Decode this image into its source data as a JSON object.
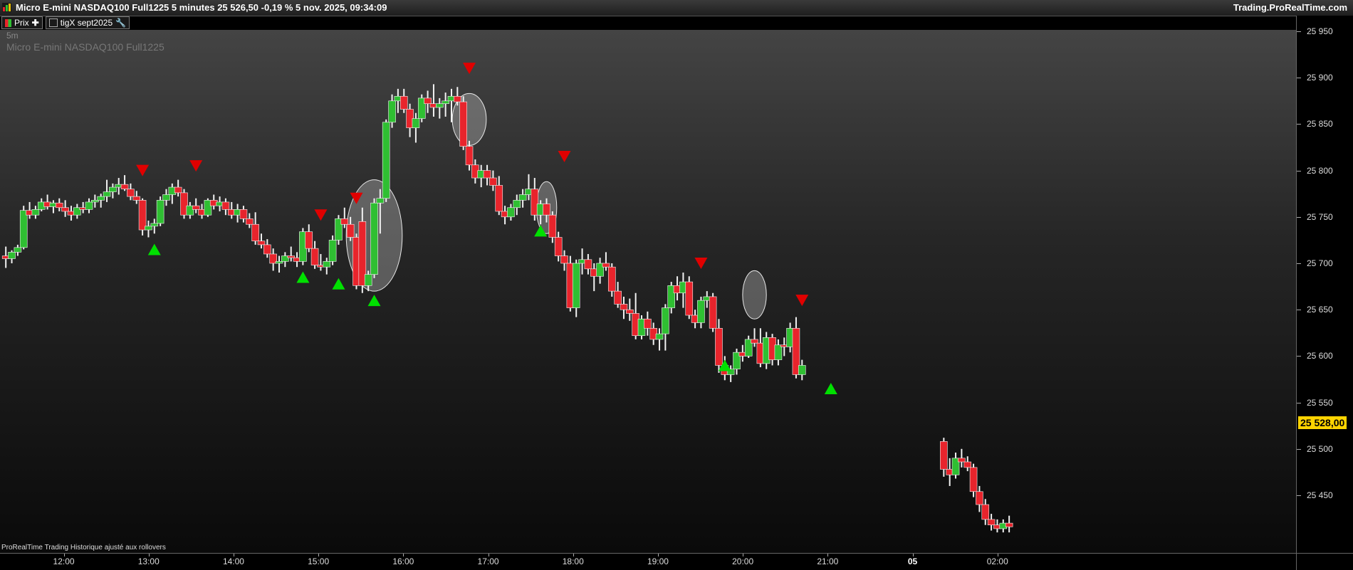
{
  "window": {
    "title": "Micro E-mini NASDAQ100 Full1225 5 minutes 25 526,50 -0,19 % 5 nov. 2025, 09:34:09",
    "brand": "Trading.ProRealTime.com"
  },
  "toolbar": {
    "price_label": "Prix",
    "indicator_label": "tigX sept2025"
  },
  "chart_labels": {
    "timeframe": "5m",
    "instrument": "Micro E-mini NASDAQ100 Full1225",
    "footer": "ProRealTime Trading  Historique ajusté aux rollovers"
  },
  "colors": {
    "up": "#2fbf32",
    "down": "#e8242c",
    "buy_signal": "#00e000",
    "sell_signal": "#e00000",
    "last_price_bg": "#ffd400"
  },
  "price_axis": {
    "labels": [
      "25 950",
      "25 900",
      "25 850",
      "25 800",
      "25 750",
      "25 700",
      "25 650",
      "25 600",
      "25 550",
      "25 500",
      "25 450"
    ],
    "last_price": "25 528,00"
  },
  "time_axis": {
    "labels": [
      {
        "text": "12:00",
        "bold": false,
        "x": 12.0
      },
      {
        "text": "13:00",
        "bold": false,
        "x": 13.0
      },
      {
        "text": "14:00",
        "bold": false,
        "x": 14.0
      },
      {
        "text": "15:00",
        "bold": false,
        "x": 15.0
      },
      {
        "text": "16:00",
        "bold": false,
        "x": 16.0
      },
      {
        "text": "17:00",
        "bold": false,
        "x": 17.0
      },
      {
        "text": "18:00",
        "bold": false,
        "x": 18.0
      },
      {
        "text": "19:00",
        "bold": false,
        "x": 19.0
      },
      {
        "text": "20:00",
        "bold": false,
        "x": 20.0
      },
      {
        "text": "21:00",
        "bold": false,
        "x": 21.0
      },
      {
        "text": "05",
        "bold": true,
        "x": 22.0
      },
      {
        "text": "02:00",
        "bold": false,
        "x": 23.0
      }
    ]
  },
  "chart_data": {
    "type": "candlestick",
    "x_unit": "hours",
    "ylim": [
      25410,
      25960
    ],
    "xlim": [
      11.32,
      24.7
    ],
    "candles": [
      [
        11.33,
        25708,
        25718,
        25695,
        25705
      ],
      [
        11.4,
        25705,
        25714,
        25700,
        25712
      ],
      [
        11.47,
        25712,
        25720,
        25708,
        25717
      ],
      [
        11.54,
        25717,
        25762,
        25715,
        25757
      ],
      [
        11.61,
        25757,
        25766,
        25748,
        25752
      ],
      [
        11.68,
        25752,
        25762,
        25748,
        25758
      ],
      [
        11.75,
        25758,
        25770,
        25756,
        25766
      ],
      [
        11.82,
        25766,
        25774,
        25758,
        25761
      ],
      [
        11.89,
        25761,
        25768,
        25754,
        25765
      ],
      [
        11.96,
        25765,
        25770,
        25756,
        25760
      ],
      [
        12.03,
        25760,
        25768,
        25750,
        25756
      ],
      [
        12.1,
        25756,
        25762,
        25746,
        25752
      ],
      [
        12.17,
        25752,
        25764,
        25748,
        25760
      ],
      [
        12.24,
        25760,
        25766,
        25754,
        25758
      ],
      [
        12.31,
        25758,
        25770,
        25754,
        25766
      ],
      [
        12.38,
        25766,
        25774,
        25760,
        25768
      ],
      [
        12.45,
        25768,
        25775,
        25760,
        25772
      ],
      [
        12.52,
        25772,
        25790,
        25766,
        25777
      ],
      [
        12.59,
        25777,
        25786,
        25770,
        25782
      ],
      [
        12.66,
        25782,
        25792,
        25774,
        25785
      ],
      [
        12.73,
        25785,
        25795,
        25778,
        25780
      ],
      [
        12.8,
        25780,
        25786,
        25768,
        25772
      ],
      [
        12.87,
        25772,
        25778,
        25764,
        25768
      ],
      [
        12.94,
        25768,
        25770,
        25730,
        25736
      ],
      [
        13.01,
        25736,
        25746,
        25728,
        25740
      ],
      [
        13.08,
        25740,
        25748,
        25732,
        25743
      ],
      [
        13.15,
        25743,
        25772,
        25740,
        25768
      ],
      [
        13.22,
        25768,
        25780,
        25762,
        25774
      ],
      [
        13.29,
        25774,
        25786,
        25764,
        25782
      ],
      [
        13.36,
        25782,
        25790,
        25772,
        25776
      ],
      [
        13.43,
        25776,
        25780,
        25748,
        25752
      ],
      [
        13.5,
        25752,
        25766,
        25748,
        25762
      ],
      [
        13.57,
        25762,
        25770,
        25754,
        25758
      ],
      [
        13.64,
        25758,
        25764,
        25748,
        25752
      ],
      [
        13.71,
        25752,
        25770,
        25750,
        25768
      ],
      [
        13.78,
        25768,
        25774,
        25758,
        25762
      ],
      [
        13.85,
        25762,
        25772,
        25756,
        25766
      ],
      [
        13.92,
        25766,
        25770,
        25752,
        25758
      ],
      [
        13.99,
        25758,
        25766,
        25748,
        25752
      ],
      [
        14.06,
        25752,
        25764,
        25744,
        25758
      ],
      [
        14.13,
        25758,
        25762,
        25744,
        25748
      ],
      [
        14.2,
        25748,
        25754,
        25738,
        25742
      ],
      [
        14.27,
        25742,
        25755,
        25720,
        25724
      ],
      [
        14.34,
        25724,
        25732,
        25716,
        25720
      ],
      [
        14.41,
        25720,
        25726,
        25706,
        25710
      ],
      [
        14.48,
        25710,
        25716,
        25692,
        25700
      ],
      [
        14.55,
        25700,
        25708,
        25690,
        25702
      ],
      [
        14.62,
        25702,
        25712,
        25696,
        25708
      ],
      [
        14.69,
        25708,
        25718,
        25702,
        25706
      ],
      [
        14.76,
        25706,
        25712,
        25696,
        25702
      ],
      [
        14.83,
        25702,
        25738,
        25698,
        25734
      ],
      [
        14.9,
        25734,
        25742,
        25712,
        25716
      ],
      [
        14.97,
        25716,
        25724,
        25694,
        25698
      ],
      [
        15.04,
        25698,
        25710,
        25692,
        25696
      ],
      [
        15.11,
        25696,
        25706,
        25688,
        25702
      ],
      [
        15.18,
        25702,
        25730,
        25698,
        25725
      ],
      [
        15.25,
        25725,
        25752,
        25720,
        25748
      ],
      [
        15.32,
        25748,
        25760,
        25738,
        25742
      ],
      [
        15.39,
        25742,
        25750,
        25724,
        25728
      ],
      [
        15.46,
        25728,
        25732,
        25672,
        25676
      ],
      [
        15.53,
        25745,
        25760,
        25668,
        25676
      ],
      [
        15.6,
        25676,
        25692,
        25670,
        25688
      ],
      [
        15.67,
        25688,
        25770,
        25684,
        25765
      ],
      [
        15.74,
        25765,
        25780,
        25732,
        25770
      ],
      [
        15.81,
        25770,
        25855,
        25766,
        25852
      ],
      [
        15.88,
        25852,
        25882,
        25846,
        25875
      ],
      [
        15.95,
        25875,
        25888,
        25862,
        25880
      ],
      [
        16.02,
        25880,
        25888,
        25862,
        25866
      ],
      [
        16.09,
        25866,
        25872,
        25836,
        25846
      ],
      [
        16.16,
        25846,
        25862,
        25830,
        25856
      ],
      [
        16.23,
        25856,
        25882,
        25852,
        25878
      ],
      [
        16.3,
        25878,
        25886,
        25862,
        25872
      ],
      [
        16.37,
        25872,
        25893,
        25858,
        25868
      ],
      [
        16.44,
        25868,
        25878,
        25856,
        25872
      ],
      [
        16.51,
        25872,
        25884,
        25858,
        25875
      ],
      [
        16.58,
        25875,
        25888,
        25852,
        25880
      ],
      [
        16.65,
        25880,
        25890,
        25870,
        25874
      ],
      [
        16.72,
        25874,
        25880,
        25822,
        25826
      ],
      [
        16.79,
        25826,
        25832,
        25800,
        25806
      ],
      [
        16.86,
        25806,
        25812,
        25786,
        25792
      ],
      [
        16.93,
        25792,
        25806,
        25782,
        25800
      ],
      [
        17.0,
        25800,
        25806,
        25784,
        25792
      ],
      [
        17.07,
        25792,
        25800,
        25778,
        25784
      ],
      [
        17.14,
        25784,
        25794,
        25752,
        25756
      ],
      [
        17.21,
        25756,
        25762,
        25742,
        25750
      ],
      [
        17.28,
        25750,
        25764,
        25746,
        25760
      ],
      [
        17.35,
        25760,
        25774,
        25752,
        25768
      ],
      [
        17.42,
        25768,
        25780,
        25760,
        25774
      ],
      [
        17.49,
        25774,
        25796,
        25768,
        25780
      ],
      [
        17.56,
        25780,
        25792,
        25746,
        25752
      ],
      [
        17.63,
        25752,
        25768,
        25742,
        25764
      ],
      [
        17.7,
        25764,
        25770,
        25744,
        25752
      ],
      [
        17.77,
        25752,
        25756,
        25722,
        25728
      ],
      [
        17.84,
        25728,
        25734,
        25702,
        25708
      ],
      [
        17.91,
        25708,
        25714,
        25692,
        25700
      ],
      [
        17.98,
        25700,
        25708,
        25648,
        25652
      ],
      [
        18.05,
        25652,
        25704,
        25642,
        25700
      ],
      [
        18.12,
        25700,
        25716,
        25688,
        25704
      ],
      [
        18.19,
        25704,
        25710,
        25688,
        25694
      ],
      [
        18.26,
        25694,
        25700,
        25670,
        25686
      ],
      [
        18.33,
        25686,
        25706,
        25678,
        25700
      ],
      [
        18.4,
        25700,
        25712,
        25692,
        25696
      ],
      [
        18.47,
        25696,
        25700,
        25664,
        25670
      ],
      [
        18.54,
        25670,
        25680,
        25652,
        25656
      ],
      [
        18.61,
        25656,
        25664,
        25640,
        25650
      ],
      [
        18.68,
        25650,
        25662,
        25638,
        25646
      ],
      [
        18.75,
        25646,
        25668,
        25618,
        25622
      ],
      [
        18.82,
        25622,
        25644,
        25618,
        25640
      ],
      [
        18.89,
        25640,
        25648,
        25622,
        25630
      ],
      [
        18.96,
        25630,
        25636,
        25612,
        25618
      ],
      [
        19.03,
        25618,
        25630,
        25606,
        25624
      ],
      [
        19.1,
        25624,
        25656,
        25606,
        25652
      ],
      [
        19.17,
        25652,
        25680,
        25646,
        25676
      ],
      [
        19.24,
        25676,
        25686,
        25660,
        25668
      ],
      [
        19.31,
        25668,
        25690,
        25652,
        25680
      ],
      [
        19.38,
        25680,
        25686,
        25640,
        25644
      ],
      [
        19.45,
        25644,
        25650,
        25630,
        25636
      ],
      [
        19.52,
        25636,
        25664,
        25630,
        25660
      ],
      [
        19.59,
        25660,
        25670,
        25652,
        25664
      ],
      [
        19.66,
        25664,
        25668,
        25626,
        25630
      ],
      [
        19.73,
        25630,
        25640,
        25582,
        25590
      ],
      [
        19.8,
        25590,
        25600,
        25574,
        25580
      ],
      [
        19.87,
        25580,
        25590,
        25572,
        25586
      ],
      [
        19.94,
        25586,
        25608,
        25580,
        25604
      ],
      [
        20.01,
        25604,
        25612,
        25594,
        25600
      ],
      [
        20.08,
        25600,
        25622,
        25598,
        25618
      ],
      [
        20.15,
        25618,
        25630,
        25610,
        25614
      ],
      [
        20.22,
        25614,
        25630,
        25588,
        25592
      ],
      [
        20.29,
        25592,
        25626,
        25586,
        25620
      ],
      [
        20.36,
        25620,
        25624,
        25590,
        25596
      ],
      [
        20.43,
        25596,
        25618,
        25590,
        25612
      ],
      [
        20.5,
        25612,
        25620,
        25600,
        25610
      ],
      [
        20.57,
        25610,
        25636,
        25604,
        25630
      ],
      [
        20.64,
        25630,
        25642,
        25576,
        25580
      ],
      [
        20.71,
        25580,
        25596,
        25574,
        25590
      ]
    ],
    "candles_b": [
      [
        22.38,
        25508,
        25512,
        25470,
        25478
      ],
      [
        22.45,
        25478,
        25490,
        25460,
        25472
      ],
      [
        22.52,
        25472,
        25496,
        25468,
        25490
      ],
      [
        22.59,
        25490,
        25500,
        25480,
        25486
      ],
      [
        22.66,
        25486,
        25492,
        25476,
        25480
      ],
      [
        22.73,
        25480,
        25484,
        25448,
        25454
      ],
      [
        22.8,
        25454,
        25460,
        25432,
        25440
      ],
      [
        22.87,
        25440,
        25446,
        25418,
        25424
      ],
      [
        22.94,
        25424,
        25430,
        25412,
        25418
      ],
      [
        23.01,
        25418,
        25424,
        25410,
        25414
      ],
      [
        23.08,
        25414,
        25424,
        25410,
        25420
      ],
      [
        23.15,
        25420,
        25428,
        25410,
        25416
      ]
    ],
    "signals": [
      {
        "type": "sell",
        "x": 12.94,
        "y": 25800
      },
      {
        "type": "sell",
        "x": 13.57,
        "y": 25805
      },
      {
        "type": "sell",
        "x": 15.04,
        "y": 25752
      },
      {
        "type": "sell",
        "x": 15.46,
        "y": 25770
      },
      {
        "type": "sell",
        "x": 16.79,
        "y": 25910
      },
      {
        "type": "sell",
        "x": 17.91,
        "y": 25815
      },
      {
        "type": "sell",
        "x": 19.52,
        "y": 25700
      },
      {
        "type": "sell",
        "x": 20.71,
        "y": 25660
      },
      {
        "type": "buy",
        "x": 13.08,
        "y": 25715
      },
      {
        "type": "buy",
        "x": 14.83,
        "y": 25685
      },
      {
        "type": "buy",
        "x": 15.25,
        "y": 25678
      },
      {
        "type": "buy",
        "x": 15.67,
        "y": 25660
      },
      {
        "type": "buy",
        "x": 17.63,
        "y": 25735
      },
      {
        "type": "buy",
        "x": 19.8,
        "y": 25590
      },
      {
        "type": "buy",
        "x": 21.05,
        "y": 25565
      }
    ],
    "highlights": [
      {
        "cx": 15.67,
        "cy": 25730,
        "rx": 0.33,
        "ry": 60
      },
      {
        "cx": 16.79,
        "cy": 25855,
        "rx": 0.2,
        "ry": 28
      },
      {
        "cx": 17.7,
        "cy": 25760,
        "rx": 0.12,
        "ry": 28
      },
      {
        "cx": 20.15,
        "cy": 25666,
        "rx": 0.14,
        "ry": 26
      }
    ]
  }
}
